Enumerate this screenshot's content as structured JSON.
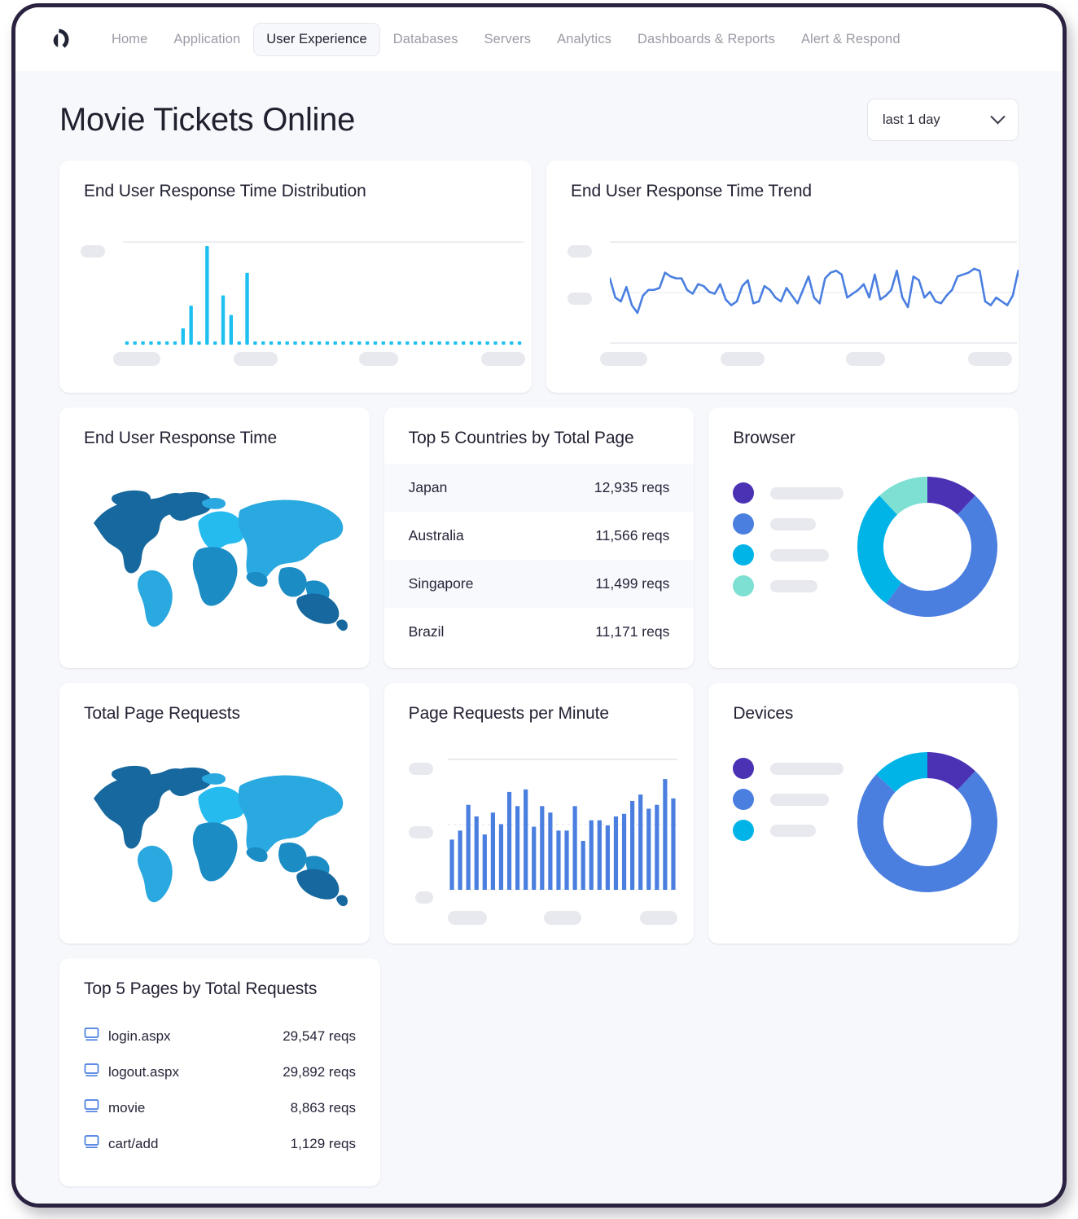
{
  "brand": {
    "logo_icon": "appdynamics-logo-icon"
  },
  "nav": {
    "items": [
      {
        "label": "Home",
        "active": false
      },
      {
        "label": "Application",
        "active": false
      },
      {
        "label": "User Experience",
        "active": true
      },
      {
        "label": "Databases",
        "active": false
      },
      {
        "label": "Servers",
        "active": false
      },
      {
        "label": "Analytics",
        "active": false
      },
      {
        "label": "Dashboards & Reports",
        "active": false
      },
      {
        "label": "Alert & Respond",
        "active": false
      }
    ]
  },
  "header": {
    "title": "Movie Tickets Online",
    "time_range": {
      "value": "last 1 day",
      "icon": "chevron-down-icon"
    }
  },
  "cards": {
    "response_time_distribution": {
      "title": "End User Response Time Distribution"
    },
    "response_time_trend": {
      "title": "End User Response Time Trend"
    },
    "response_time_map": {
      "title": "End User Response Time"
    },
    "top_countries": {
      "title": "Top 5 Countries by Total Page"
    },
    "browser": {
      "title": "Browser"
    },
    "total_page_requests": {
      "title": "Total Page Requests"
    },
    "page_requests_per_minute": {
      "title": "Page Requests per Minute"
    },
    "devices": {
      "title": "Devices"
    },
    "top_pages": {
      "title": "Top 5 Pages by Total Requests"
    }
  },
  "top_countries_rows": [
    {
      "country": "Japan",
      "requests": "12,935 reqs"
    },
    {
      "country": "Australia",
      "requests": "11,566 reqs"
    },
    {
      "country": "Singapore",
      "requests": "11,499 reqs"
    },
    {
      "country": "Brazil",
      "requests": "11,171 reqs"
    }
  ],
  "top_pages_rows": [
    {
      "icon": "monitor-icon",
      "page": "login.aspx",
      "requests": "29,547 reqs"
    },
    {
      "icon": "monitor-icon",
      "page": "logout.aspx",
      "requests": "29,892 reqs"
    },
    {
      "icon": "monitor-icon",
      "page": "movie",
      "requests": "8,863 reqs"
    },
    {
      "icon": "monitor-icon",
      "page": "cart/add",
      "requests": "1,129 reqs"
    }
  ],
  "colors": {
    "accent_cyan": "#1ec0f0",
    "accent_blue": "#4a7fe0",
    "accent_purple": "#4b32b5",
    "accent_teal": "#7de0d3",
    "map_dark": "#16689e",
    "map_mid": "#1b8cc4",
    "map_light": "#2aa8e0",
    "skeleton": "#e8e9ee",
    "page_bg": "#f7f8fc",
    "frame": "#2a2240"
  },
  "chart_data": [
    {
      "id": "response_time_distribution",
      "type": "bar",
      "title": "End User Response Time Distribution",
      "xlabel": "",
      "ylabel": "",
      "grid": true,
      "axis_labels_masked": true,
      "y_tick_count": 2,
      "x_tick_count": 4,
      "ylim": [
        0,
        100
      ],
      "values": [
        2,
        2,
        2,
        2,
        2,
        2,
        2,
        16,
        38,
        2,
        96,
        2,
        48,
        29,
        2,
        70,
        2,
        2,
        2,
        2,
        2,
        2,
        2,
        2,
        2,
        2,
        2,
        2,
        2,
        2,
        2,
        2,
        2,
        2,
        2,
        2,
        2,
        2,
        2,
        2,
        2,
        2,
        2,
        2,
        2,
        2,
        2,
        2,
        2,
        2
      ]
    },
    {
      "id": "response_time_trend",
      "type": "line",
      "title": "End User Response Time Trend",
      "xlabel": "",
      "ylabel": "",
      "grid": true,
      "axis_labels_masked": true,
      "y_tick_count": 3,
      "x_tick_count": 4,
      "ylim": [
        0,
        100
      ],
      "values": [
        64,
        44,
        40,
        55,
        36,
        28,
        46,
        52,
        52,
        54,
        70,
        66,
        64,
        64,
        52,
        48,
        58,
        56,
        50,
        48,
        58,
        42,
        36,
        40,
        56,
        62,
        38,
        40,
        56,
        52,
        44,
        40,
        54,
        46,
        38,
        52,
        66,
        44,
        38,
        64,
        70,
        72,
        68,
        44,
        48,
        52,
        58,
        44,
        68,
        42,
        46,
        52,
        72,
        44,
        34,
        66,
        62,
        44,
        50,
        40,
        38,
        46,
        52,
        66,
        68,
        70,
        74,
        72,
        40,
        36,
        44,
        40,
        36,
        46,
        72,
        44,
        58,
        42
      ]
    },
    {
      "id": "page_requests_per_minute",
      "type": "bar",
      "title": "Page Requests per Minute",
      "xlabel": "",
      "ylabel": "",
      "grid": true,
      "axis_labels_masked": true,
      "y_tick_count": 3,
      "x_tick_count": 3,
      "ylim": [
        0,
        100
      ],
      "values": [
        39,
        46,
        66,
        57,
        43,
        60,
        51,
        76,
        65,
        78,
        49,
        65,
        60,
        46,
        46,
        65,
        38,
        54,
        54,
        50,
        57,
        59,
        69,
        74,
        63,
        66,
        86,
        71
      ]
    },
    {
      "id": "browser",
      "type": "pie",
      "title": "Browser",
      "legend_position": "left",
      "legend_masked": true,
      "labels": [
        "",
        "",
        "",
        ""
      ],
      "values": [
        12,
        48,
        28,
        12
      ],
      "colors": [
        "#4b32b5",
        "#4a7fe0",
        "#00b4e8",
        "#7de0d3"
      ]
    },
    {
      "id": "devices",
      "type": "pie",
      "title": "Devices",
      "legend_position": "left",
      "legend_masked": true,
      "labels": [
        "",
        "",
        ""
      ],
      "values": [
        12,
        75,
        13
      ],
      "colors": [
        "#4b32b5",
        "#4a7fe0",
        "#00b4e8"
      ]
    },
    {
      "id": "response_time_map",
      "type": "heatmap",
      "title": "End User Response Time",
      "regions": [
        "North America",
        "South America",
        "Europe",
        "Africa",
        "Asia",
        "Australia"
      ]
    },
    {
      "id": "total_page_requests_map",
      "type": "heatmap",
      "title": "Total Page Requests",
      "regions": [
        "North America",
        "South America",
        "Europe",
        "Africa",
        "Asia",
        "Australia"
      ]
    }
  ]
}
